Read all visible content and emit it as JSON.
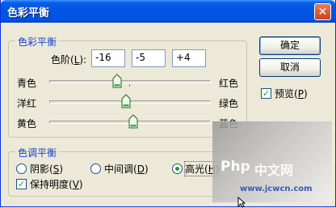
{
  "window": {
    "title": "色彩平衡",
    "close_icon": "close-icon"
  },
  "color_balance": {
    "legend": "色彩平衡",
    "levels_label": "色阶(",
    "levels_key": "L",
    "levels_label_end": "):",
    "levels": [
      "-16",
      "-5",
      "+4"
    ],
    "sliders": [
      {
        "left": "青色",
        "right": "红色",
        "value": -16
      },
      {
        "left": "洋红",
        "right": "绿色",
        "value": -5
      },
      {
        "left": "黄色",
        "right": "蓝色",
        "value": 4
      }
    ],
    "slider_min": -100,
    "slider_max": 100
  },
  "tone_balance": {
    "legend": "色调平衡",
    "options": [
      {
        "label": "阴影(",
        "key": "S",
        "end": ")",
        "selected": false
      },
      {
        "label": "中间调(",
        "key": "D",
        "end": ")",
        "selected": false
      },
      {
        "label": "高光(",
        "key": "H",
        "end": ")",
        "selected": true
      }
    ],
    "preserve_label": "保持明度(",
    "preserve_key": "V",
    "preserve_end": ")",
    "preserve_checked": true
  },
  "buttons": {
    "ok": "确定",
    "cancel": "取消"
  },
  "preview": {
    "label": "预览(",
    "key": "P",
    "end": ")",
    "checked": true
  },
  "watermark": {
    "brand": "Php",
    "cn": "中文网",
    "url": "www.jcwcn.com"
  }
}
